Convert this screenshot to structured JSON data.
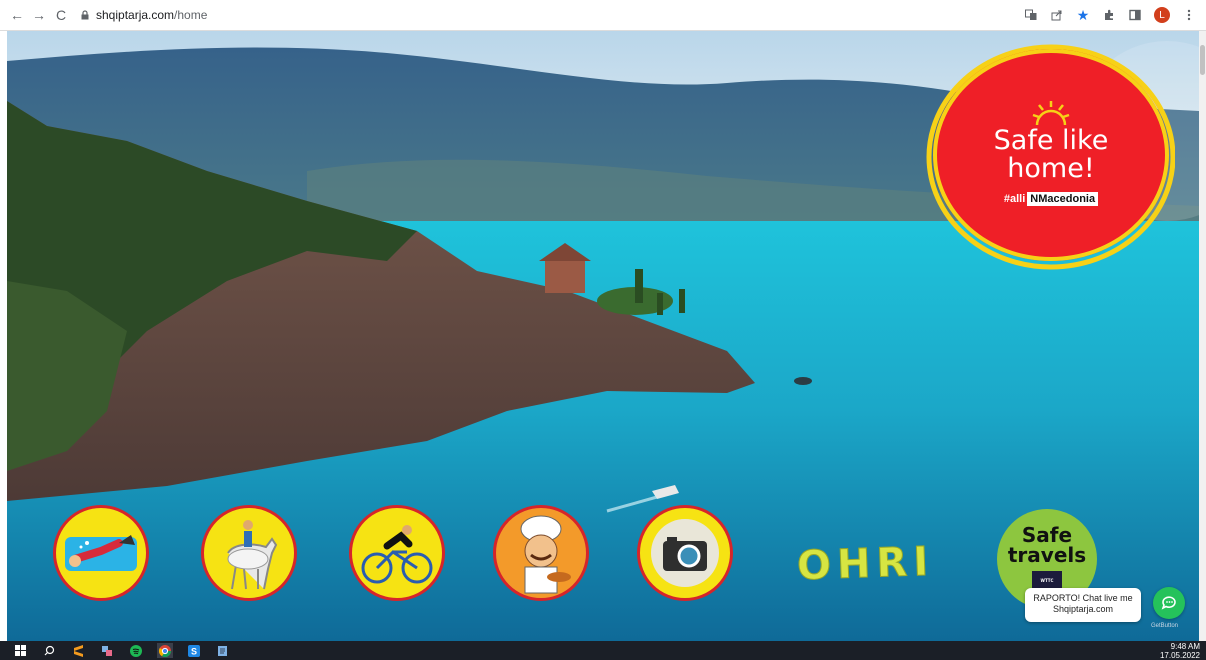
{
  "browser": {
    "url_host": "shqiptarja.com",
    "url_path": "/home",
    "back_label": "←",
    "forward_label": "→",
    "reload_label": "C",
    "profile_initial": "L"
  },
  "badge": {
    "line1": "Safe like",
    "line2": "home!",
    "hashtag_prefix": "#alli",
    "hashtag_highlight": "NMacedonia"
  },
  "activities": [
    {
      "name": "diving"
    },
    {
      "name": "horse-riding"
    },
    {
      "name": "cycling"
    },
    {
      "name": "chef"
    },
    {
      "name": "camera"
    }
  ],
  "title_text": "OHRI",
  "safe_travels": {
    "line1": "Safe",
    "line2": "travels",
    "logo": "WORLD TRAVEL & TOURISM COUNCIL"
  },
  "chat": {
    "text": "RAPORTO! Chat live me Shqiptarja.com",
    "powered": "GetButton"
  },
  "taskbar": {
    "time": "9:48 AM",
    "date": "17.05.2022"
  },
  "colors": {
    "lake": "#1fb4cf",
    "badge_red": "#ef1f27",
    "activity_yellow": "#f6e313",
    "ohri_green": "#d7e542",
    "safe_travels_green": "#8dc63f",
    "chat_green": "#25c25b"
  }
}
